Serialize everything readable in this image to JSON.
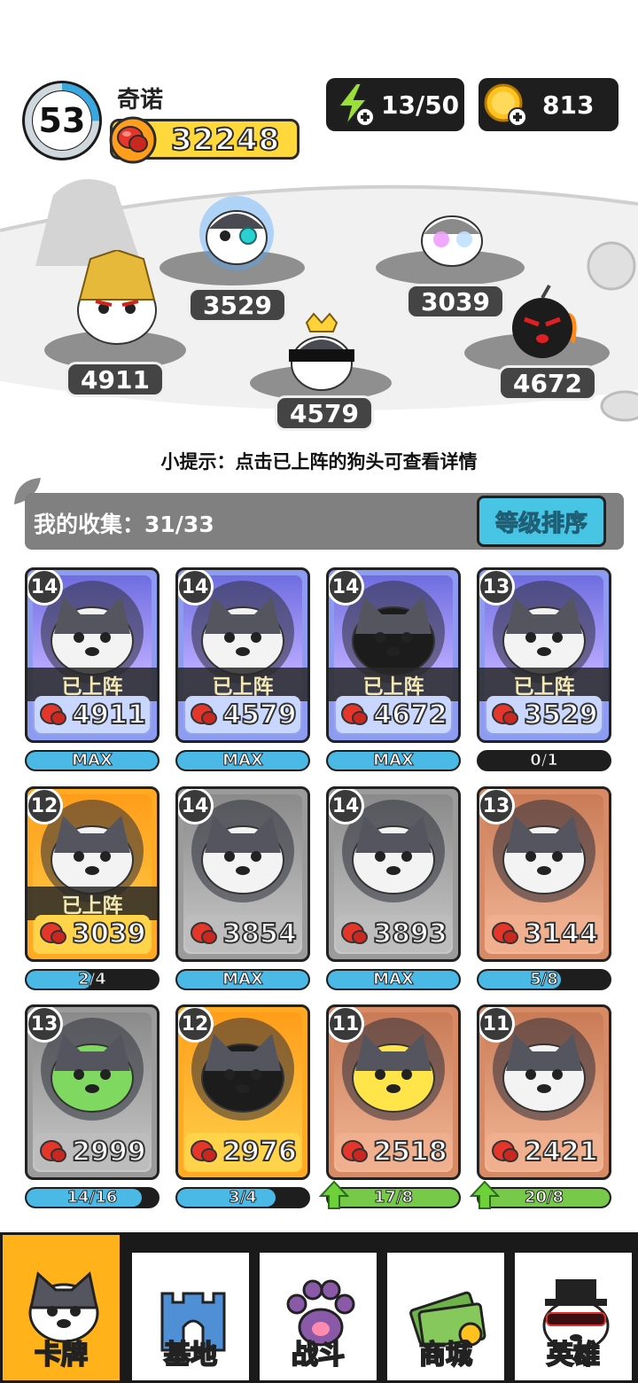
{
  "player": {
    "level": "53",
    "name": "奇诺",
    "power": "32248",
    "level_progress": 0.25
  },
  "resources": {
    "energy": "13/50",
    "coins": "813"
  },
  "arena": {
    "powers": [
      "4911",
      "3529",
      "4579",
      "3039",
      "4672"
    ]
  },
  "tip": "小提示：点击已上阵的狗头可查看详情",
  "collection": {
    "label": "我的收集：31/33",
    "sort_button": "等级排序"
  },
  "cards": [
    {
      "level": "14",
      "power": "4911",
      "deployed": "已上阵",
      "progress": "MAX",
      "fill": 1.0,
      "tier": "blue"
    },
    {
      "level": "14",
      "power": "4579",
      "deployed": "已上阵",
      "progress": "MAX",
      "fill": 1.0,
      "tier": "blue"
    },
    {
      "level": "14",
      "power": "4672",
      "deployed": "已上阵",
      "progress": "MAX",
      "fill": 1.0,
      "tier": "blue"
    },
    {
      "level": "13",
      "power": "3529",
      "deployed": "已上阵",
      "progress": "0/1",
      "fill": 0.0,
      "tier": "blue"
    },
    {
      "level": "12",
      "power": "3039",
      "deployed": "已上阵",
      "progress": "2/4",
      "fill": 0.5,
      "tier": "gold"
    },
    {
      "level": "14",
      "power": "3854",
      "deployed": "",
      "progress": "MAX",
      "fill": 1.0,
      "tier": "grey"
    },
    {
      "level": "14",
      "power": "3893",
      "deployed": "",
      "progress": "MAX",
      "fill": 1.0,
      "tier": "grey"
    },
    {
      "level": "13",
      "power": "3144",
      "deployed": "",
      "progress": "5/8",
      "fill": 0.625,
      "tier": "bronze"
    },
    {
      "level": "13",
      "power": "2999",
      "deployed": "",
      "progress": "14/16",
      "fill": 0.875,
      "tier": "grey"
    },
    {
      "level": "12",
      "power": "2976",
      "deployed": "",
      "progress": "3/4",
      "fill": 0.75,
      "tier": "gold"
    },
    {
      "level": "11",
      "power": "2518",
      "deployed": "",
      "progress": "17/8",
      "fill": 1.0,
      "tier": "bronze",
      "upgradable": true
    },
    {
      "level": "11",
      "power": "2421",
      "deployed": "",
      "progress": "20/8",
      "fill": 1.0,
      "tier": "bronze",
      "upgradable": true
    }
  ],
  "nav": {
    "tabs": [
      "卡牌",
      "基地",
      "战斗",
      "商城",
      "英雄"
    ],
    "active": 0
  },
  "colors": {
    "accent": "#ffb21a",
    "sort_button": "#48c4e4",
    "progress_blue": "#4bb9e6",
    "progress_green": "#77c94a"
  }
}
